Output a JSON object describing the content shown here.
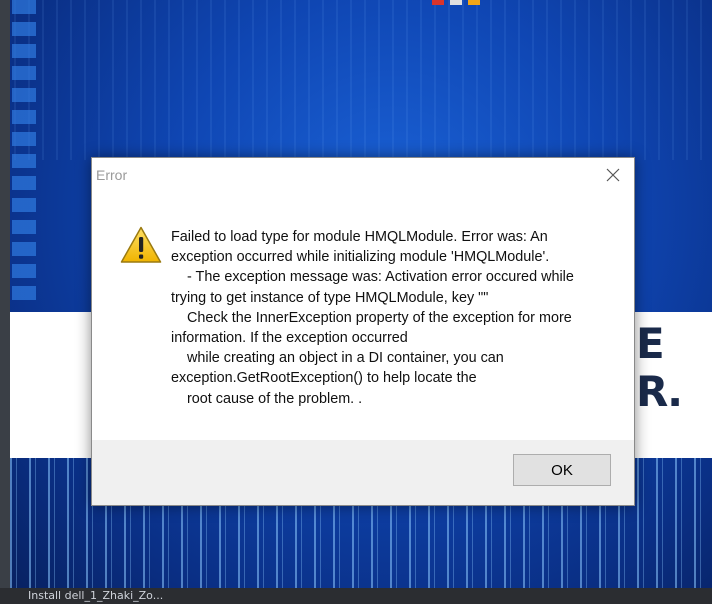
{
  "dialog": {
    "title": "Error",
    "close_icon": "close-icon",
    "warning_icon": "warning-triangle-icon",
    "message_lines": [
      "Failed to load type for module HMQLModule. Error was: An",
      "exception occurred while initializing module 'HMQLModule'.",
      "    - The exception message was: Activation error occured while",
      "trying to get instance of type HMQLModule, key \"\"",
      "    Check the InnerException property of the exception for more",
      "information. If the exception occurred",
      "    while creating an object in a DI container, you can",
      "exception.GetRootException() to help locate the",
      "    root cause of the problem. ."
    ],
    "ok_label": "OK"
  },
  "background": {
    "letters": [
      "E",
      "R."
    ],
    "bottom_text": "Install         dell_1_Zhaki_Zo..."
  },
  "colors": {
    "desktop_blue": "#0f46b3",
    "dialog_footer": "#f0f0f0",
    "button_face": "#e1e1e1",
    "warning_yellow": "#f3c21b"
  }
}
